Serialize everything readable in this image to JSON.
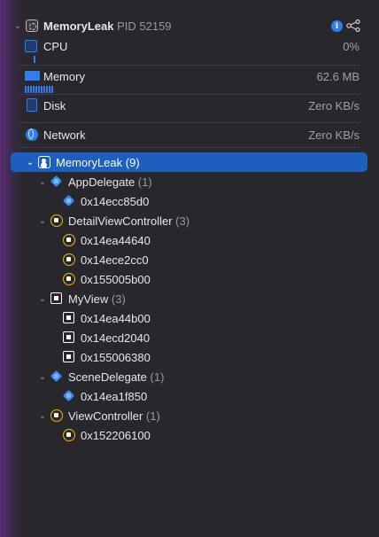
{
  "process": {
    "name": "MemoryLeak",
    "pid": "PID 52159"
  },
  "gauges": [
    {
      "label": "CPU",
      "value": "0%",
      "level": 0.1
    },
    {
      "label": "Memory",
      "value": "62.6 MB",
      "level": 0.8
    },
    {
      "label": "Disk",
      "value": "Zero KB/s"
    },
    {
      "label": "Network",
      "value": "Zero KB/s"
    }
  ],
  "tree": {
    "root": {
      "name": "MemoryLeak",
      "count": "(9)"
    },
    "groups": [
      {
        "name": "AppDelegate",
        "count": "(1)",
        "icon": "swift-class-icon",
        "items": [
          "0x14ecc85d0"
        ]
      },
      {
        "name": "DetailViewController",
        "count": "(3)",
        "icon": "object-icon",
        "items": [
          "0x14ea44640",
          "0x14ece2cc0",
          "0x155005b00"
        ]
      },
      {
        "name": "MyView",
        "count": "(3)",
        "icon": "view-icon",
        "items": [
          "0x14ea44b00",
          "0x14ecd2040",
          "0x155006380"
        ]
      },
      {
        "name": "SceneDelegate",
        "count": "(1)",
        "icon": "swift-class-icon",
        "items": [
          "0x14ea1f850"
        ]
      },
      {
        "name": "ViewController",
        "count": "(1)",
        "icon": "object-icon",
        "items": [
          "0x152206100"
        ]
      }
    ]
  },
  "colors": {
    "selection": "#1d5fbf",
    "accent": "#2f7ef0",
    "object": "#f2b705",
    "background": "#28272b"
  }
}
